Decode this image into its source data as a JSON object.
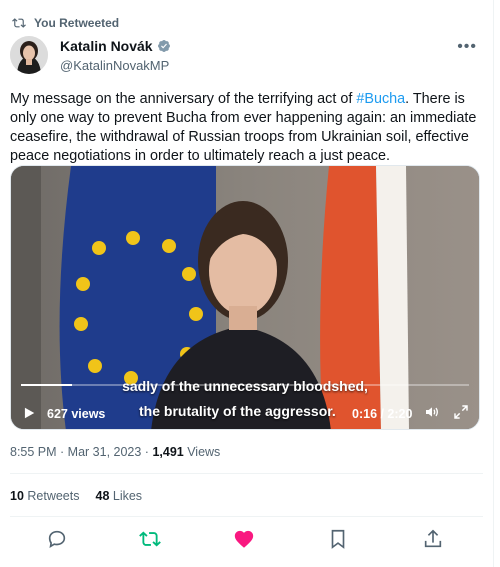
{
  "retweet": {
    "label": "You Retweeted",
    "icon": "retweet-icon"
  },
  "author": {
    "name": "Katalin Novák",
    "handle": "@KatalinNovakMP",
    "verified": true
  },
  "tweet": {
    "text_before": "My message on the anniversary of the terrifying act of ",
    "hashtag": "#Bucha",
    "text_after": ". There is only one way to prevent Bucha from ever happening again: an immediate ceasefire, the withdrawal of Russian troops from Ukrainian soil, effective peace negotiations in order to ultimately reach a just peace."
  },
  "video": {
    "subtitle_line1": "sadly of the unnecessary bloodshed,",
    "subtitle_line2": "the brutality of the aggressor.",
    "views": "627 views",
    "time": "0:16 / 2:20",
    "progress": 0.114
  },
  "meta": {
    "time": "8:55 PM · Mar 31, 2023 · ",
    "views_count": "1,491",
    "views_label": " Views"
  },
  "stats": {
    "retweets_count": "10",
    "retweets_label": " Retweets",
    "likes_count": "48",
    "likes_label": " Likes"
  },
  "colors": {
    "accent": "#1d9bf0",
    "retweet_green": "#00ba7c",
    "like_pink": "#f91880",
    "muted": "#536471"
  }
}
